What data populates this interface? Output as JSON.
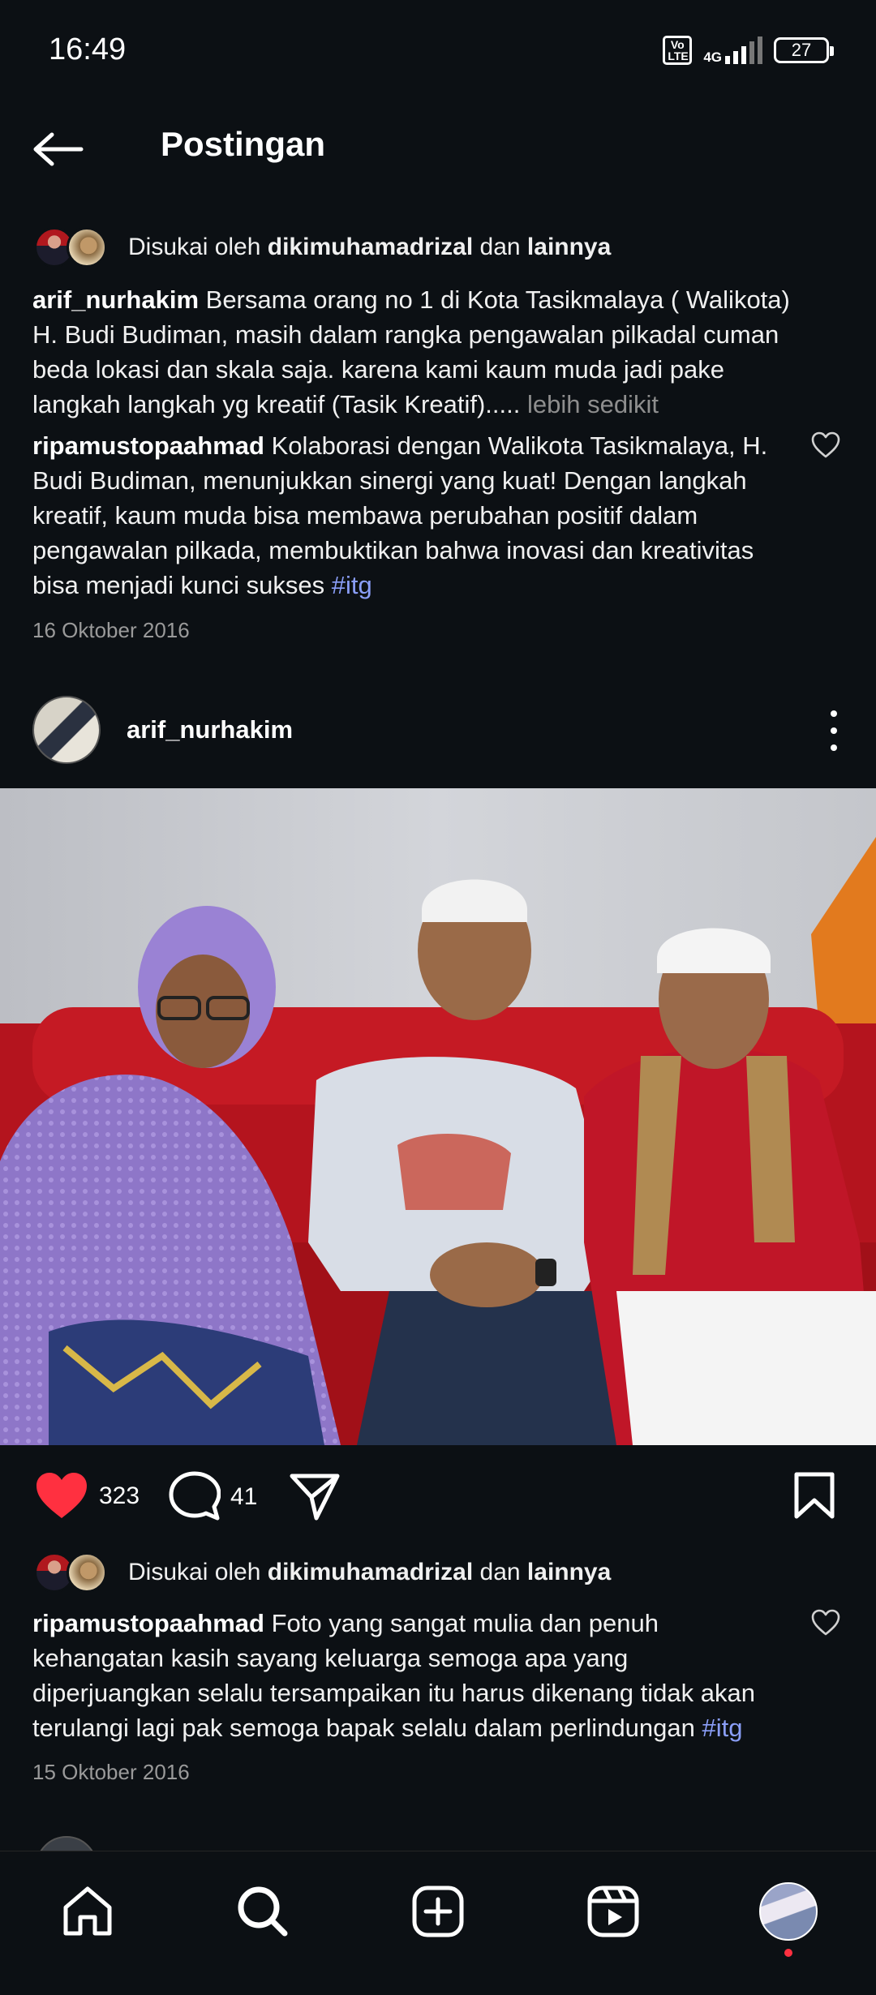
{
  "status_bar": {
    "time": "16:49",
    "volte": "Vo LTE",
    "network": "4G",
    "battery": "27"
  },
  "header": {
    "title": "Postingan"
  },
  "top_post": {
    "likes_prefix": "Disukai oleh",
    "likes_user": "dikimuhamadrizal",
    "likes_mid": "dan",
    "likes_suffix": "lainnya",
    "caption_user": "arif_nurhakim",
    "caption_text": "Bersama orang no 1 di Kota Tasikmalaya ( Walikota) H. Budi Budiman, masih dalam rangka pengawalan pilkadal cuman beda lokasi dan skala saja. karena kami kaum muda jadi pake langkah langkah yg kreatif (Tasik Kreatif).....",
    "caption_more": "lebih sedikit",
    "comment_user": "ripamustopaahmad",
    "comment_text": "Kolaborasi dengan Walikota Tasikmalaya, H. Budi Budiman, menunjukkan sinergi yang kuat! Dengan langkah kreatif, kaum muda bisa membawa perubahan positif dalam pengawalan pilkada, membuktikan bahwa inovasi dan kreativitas bisa menjadi kunci sukses",
    "comment_hashtag": "#itg",
    "date": "16 Oktober 2016"
  },
  "post": {
    "username": "arif_nurhakim",
    "like_count": "323",
    "comment_count": "41",
    "likes_prefix": "Disukai oleh",
    "likes_user": "dikimuhamadrizal",
    "likes_mid": "dan",
    "likes_suffix": "lainnya",
    "comment_user": "ripamustopaahmad",
    "comment_text": "Foto yang sangat mulia dan penuh kehangatan kasih sayang keluarga semoga apa yang diperjuangkan selalu tersampaikan itu harus dikenang tidak akan terulangi lagi pak semoga bapak selalu dalam perlindungan",
    "comment_hashtag": "#itg",
    "date": "15 Oktober 2016"
  },
  "icons": {
    "back": "arrow-left-icon",
    "heart": "heart-filled-icon",
    "comment": "comment-bubble-icon",
    "share": "paper-plane-icon",
    "save": "bookmark-icon",
    "more": "vertical-dots-icon",
    "nav": [
      "home-icon",
      "search-icon",
      "add-post-icon",
      "reels-icon",
      "profile-avatar"
    ]
  },
  "colors": {
    "background": "#0c1014",
    "like_red": "#ff3040",
    "hashtag": "#8a9ef8",
    "muted_text": "#8e8e8e"
  }
}
